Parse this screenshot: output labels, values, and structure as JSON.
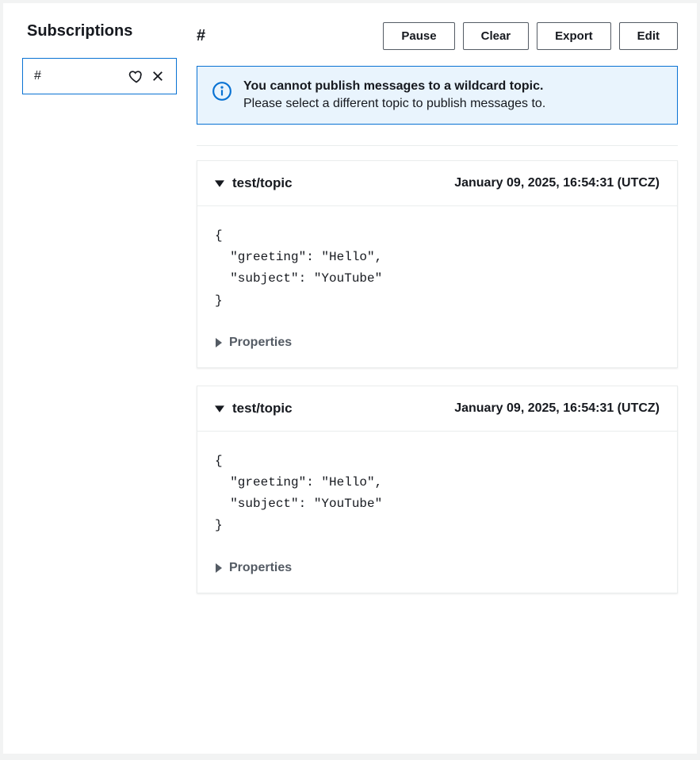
{
  "sidebar": {
    "title": "Subscriptions",
    "items": [
      {
        "topic": "#"
      }
    ]
  },
  "main": {
    "title": "#",
    "buttons": {
      "pause": "Pause",
      "clear": "Clear",
      "export": "Export",
      "edit": "Edit"
    },
    "alert": {
      "title": "You cannot publish messages to a wildcard topic.",
      "body": "Please select a different topic to publish messages to."
    },
    "messages": [
      {
        "topic": "test/topic",
        "timestamp": "January 09, 2025, 16:54:31 (UTCZ)",
        "payload": "{\n  \"greeting\": \"Hello\",\n  \"subject\": \"YouTube\"\n}",
        "properties_label": "Properties"
      },
      {
        "topic": "test/topic",
        "timestamp": "January 09, 2025, 16:54:31 (UTCZ)",
        "payload": "{\n  \"greeting\": \"Hello\",\n  \"subject\": \"YouTube\"\n}",
        "properties_label": "Properties"
      }
    ]
  }
}
